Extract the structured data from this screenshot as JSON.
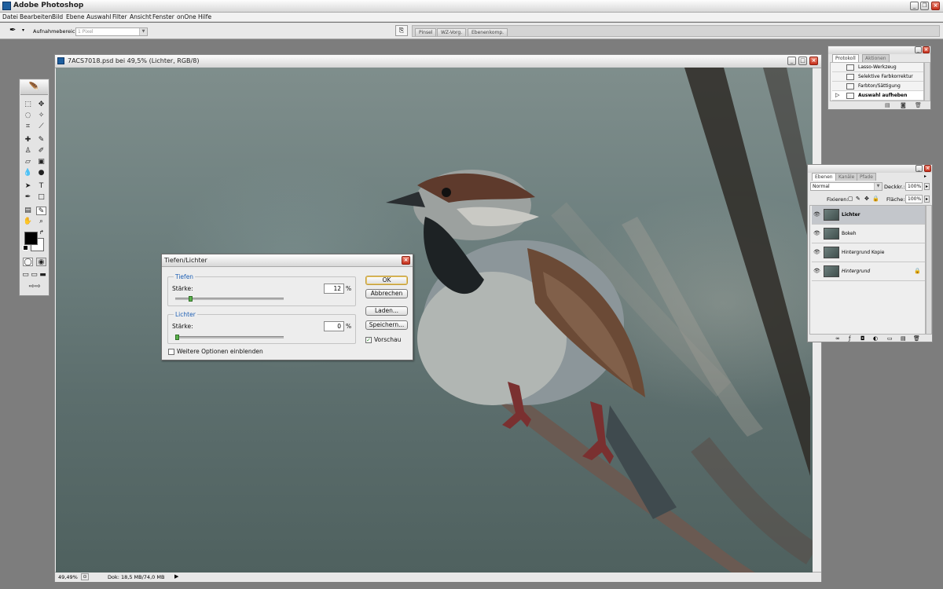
{
  "app": {
    "title": "Adobe Photoshop"
  },
  "menu": [
    "Datei",
    "Bearbeiten",
    "Bild",
    "Ebene",
    "Auswahl",
    "Filter",
    "Ansicht",
    "Fenster",
    "onOne",
    "Hilfe"
  ],
  "options_bar": {
    "sample_label": "Aufnahmebereich:",
    "sample_value": "1 Pixel",
    "well_tabs": [
      "Pinsel",
      "WZ-Vorg.",
      "Ebenenkomp."
    ]
  },
  "document": {
    "title": "7ACS7018.psd bei 49,5% (Lichter, RGB/8)",
    "zoom": "49,49%",
    "doc_info": "Dok: 18,5 MB/74,0 MB"
  },
  "dialog": {
    "title": "Tiefen/Lichter",
    "shadows_legend": "Tiefen",
    "shadows_strength_label": "Stärke:",
    "shadows_value": "12",
    "shadows_fraction": 0.12,
    "highlights_legend": "Lichter",
    "highlights_strength_label": "Stärke:",
    "highlights_value": "0",
    "highlights_fraction": 0.0,
    "percent": "%",
    "ok": "OK",
    "cancel": "Abbrechen",
    "load": "Laden...",
    "save": "Speichern...",
    "preview": "Vorschau",
    "more_options": "Weitere Optionen einblenden"
  },
  "history_panel": {
    "tabs": [
      "Protokoll",
      "Aktionen"
    ],
    "items": [
      "Lasso-Werkzeug",
      "Selektive Farbkorrektur",
      "Farbton/Sättigung",
      "Auswahl aufheben"
    ]
  },
  "layers_panel": {
    "tabs": [
      "Ebenen",
      "Kanäle",
      "Pfade"
    ],
    "blend_mode": "Normal",
    "opacity_label": "Deckkr.:",
    "opacity": "100%",
    "lock_label": "Fixieren:",
    "fill_label": "Fläche:",
    "fill": "100%",
    "layers": [
      "Lichter",
      "Bokeh",
      "Hintergrund Kopie",
      "Hintergrund"
    ]
  },
  "colors": {
    "foreground": "#000000",
    "background": "#ffffff"
  }
}
